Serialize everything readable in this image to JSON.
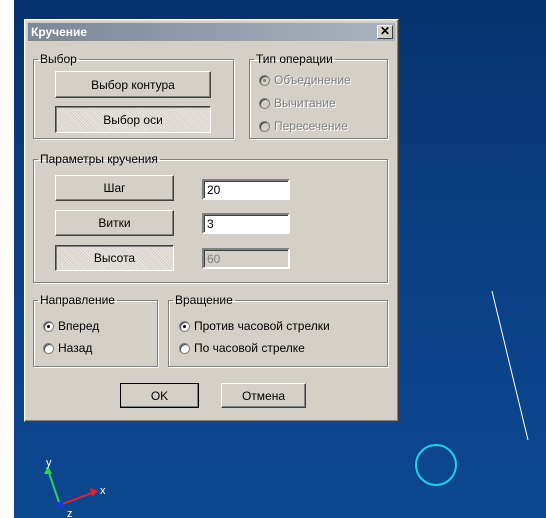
{
  "dialog": {
    "title": "Кручение",
    "close_label": "✕"
  },
  "selection": {
    "legend": "Выбор",
    "contour_button": "Выбор контура",
    "axis_button": "Выбор оси"
  },
  "operation_type": {
    "legend": "Тип операции",
    "options": [
      "Объединение",
      "Вычитание",
      "Пересечение"
    ],
    "selected": "Объединение",
    "enabled": false
  },
  "twist_params": {
    "legend": "Параметры кручения",
    "step_label": "Шаг",
    "step_value": "20",
    "turns_label": "Витки",
    "turns_value": "3",
    "height_label": "Высота",
    "height_value": "60"
  },
  "direction": {
    "legend": "Направление",
    "options": [
      "Вперед",
      "Назад"
    ],
    "selected": "Вперед"
  },
  "rotation": {
    "legend": "Вращение",
    "options": [
      "Против часовой стрелки",
      "По часовой стрелке"
    ],
    "selected": "Против часовой стрелки"
  },
  "buttons": {
    "ok": "OK",
    "cancel": "Отмена"
  },
  "viewport": {
    "axis_x": "x",
    "axis_y": "y",
    "axis_z": "z",
    "background_color": "#0a3f84",
    "circle_color": "#1fd3e8",
    "line_color": "#ffffff"
  }
}
